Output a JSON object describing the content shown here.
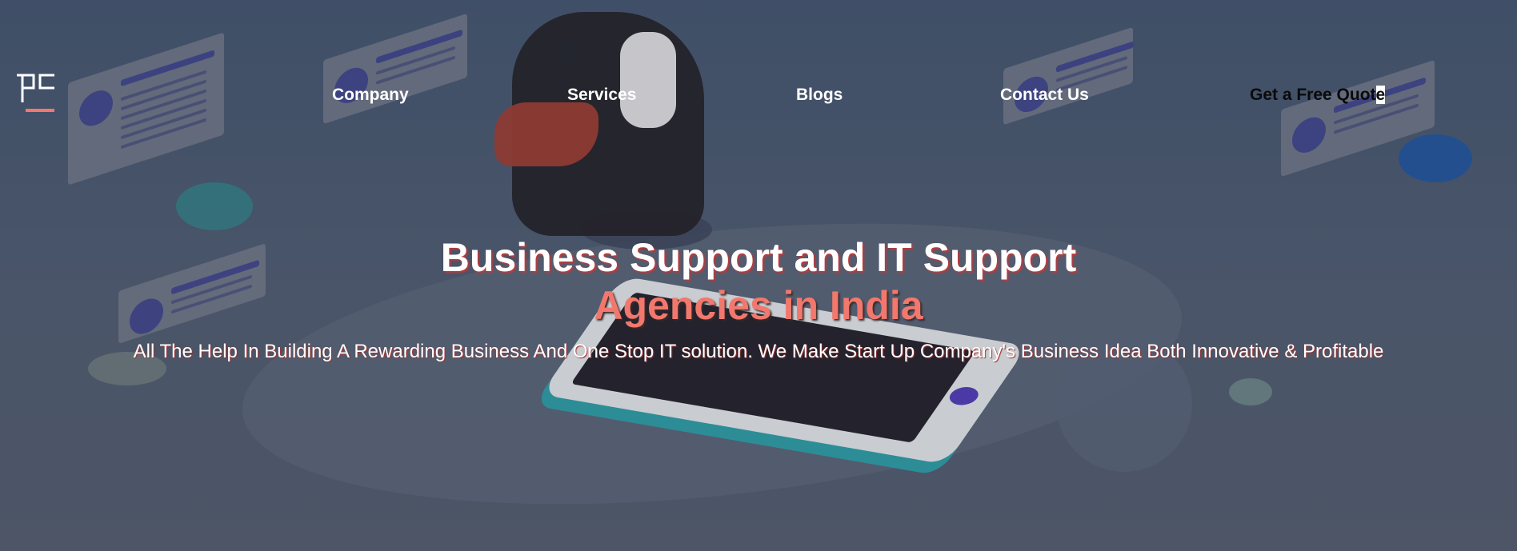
{
  "brand": {
    "logo_icon": "power2create-logo-icon",
    "accent": "#f2786d"
  },
  "nav": {
    "items": [
      {
        "label": "Company"
      },
      {
        "label": "Services"
      },
      {
        "label": "Blogs"
      },
      {
        "label": "Contact Us"
      }
    ],
    "cta_prefix": "Get a Free Quot",
    "cta_suffix": "e"
  },
  "hero": {
    "title": "Business Support and IT Support",
    "subtitle": "Agencies in India",
    "description": "All The Help In Building A Rewarding Business And One Stop IT solution. We Make Start Up Company's Business Idea Both Innovative & Profitable"
  },
  "colors": {
    "background": "#44516a",
    "title": "#ffffff",
    "subtitle": "#f2786d",
    "cta_text": "#0a0a0a"
  }
}
